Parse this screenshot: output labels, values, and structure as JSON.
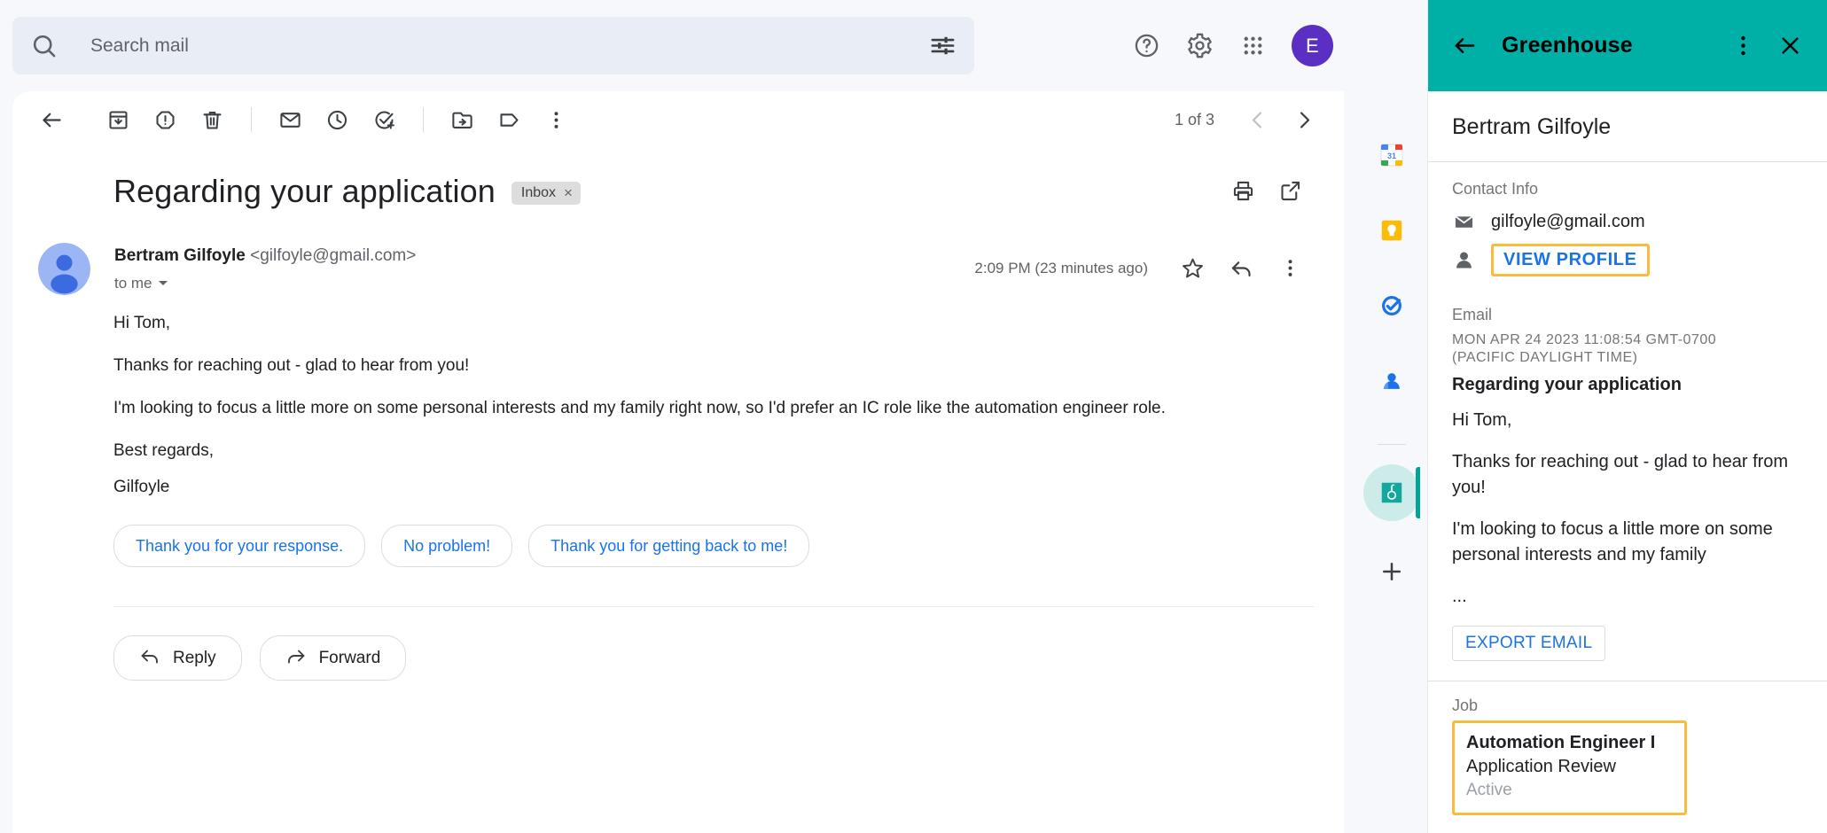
{
  "search": {
    "placeholder": "Search mail",
    "value": "",
    "icon": "search-icon",
    "options_icon": "filter-options-icon"
  },
  "top_right": {
    "help_icon": "help-icon",
    "settings_icon": "gear-icon",
    "apps_icon": "apps-grid-icon",
    "account_initial": "E",
    "account_color": "#5b2ec4"
  },
  "toolbar": {
    "back": "back-arrow-icon",
    "archive": "archive-icon",
    "spam": "report-spam-icon",
    "delete": "trash-icon",
    "mark_unread": "mark-unread-envelope-icon",
    "snooze": "clock-snooze-icon",
    "add_task": "add-to-tasks-icon",
    "move_to": "move-to-folder-icon",
    "labels": "label-tag-icon",
    "more": "more-vertical-icon",
    "pager_text": "1 of 3",
    "prev": "chevron-left-icon",
    "next": "chevron-right-icon"
  },
  "thread": {
    "subject": "Regarding your application",
    "label_chip": "Inbox",
    "label_chip_remove": "×",
    "print_icon": "print-icon",
    "popout_icon": "open-in-new-icon"
  },
  "message": {
    "sender_name": "Bertram Gilfoyle",
    "sender_email": "<gilfoyle@gmail.com>",
    "recipient": "to me",
    "timestamp": "2:09 PM (23 minutes ago)",
    "star_icon": "star-outline-icon",
    "reply_icon": "reply-arrow-icon",
    "more_icon": "more-vertical-icon",
    "body": {
      "greeting": "Hi Tom,",
      "para1": "Thanks for reaching out - glad to hear from you!",
      "para2": "I'm looking to focus a little more on some personal interests and my family right now, so I'd prefer an IC role like the automation engineer role.",
      "signoff": "Best regards,",
      "signature": "Gilfoyle"
    }
  },
  "smart_replies": [
    "Thank you for your response.",
    "No problem!",
    "Thank you for getting back to me!"
  ],
  "actions": {
    "reply_label": "Reply",
    "reply_icon": "reply-arrow-icon",
    "forward_label": "Forward",
    "forward_icon": "forward-arrow-icon"
  },
  "rail": {
    "items": [
      {
        "name": "google-calendar",
        "label": "31"
      },
      {
        "name": "google-keep",
        "label": ""
      },
      {
        "name": "google-tasks",
        "label": ""
      },
      {
        "name": "google-contacts",
        "label": ""
      }
    ],
    "addon": {
      "name": "greenhouse",
      "label": "g",
      "active": true
    },
    "add_label": "+"
  },
  "panel": {
    "title": "Greenhouse",
    "header_color": "#00b0a6",
    "back_icon": "back-arrow-icon",
    "more_icon": "more-vertical-icon",
    "close_icon": "close-icon",
    "candidate_name": "Bertram Gilfoyle",
    "contact": {
      "section_label": "Contact Info",
      "email_icon": "envelope-icon",
      "email": "gilfoyle@gmail.com",
      "profile_icon": "person-icon",
      "view_profile_label": "VIEW PROFILE",
      "view_profile_highlight": "#fbbc3d"
    },
    "email": {
      "section_label": "Email",
      "timestamp_line1": "MON APR 24 2023 11:08:54 GMT-0700",
      "timestamp_line2": "(PACIFIC DAYLIGHT TIME)",
      "subject": "Regarding your application",
      "preview_p1": "Hi Tom,",
      "preview_p2": "Thanks for reaching out - glad to hear from you!",
      "preview_p3": "I'm looking to focus a little more on some personal interests and my family",
      "preview_p4": "...",
      "export_label": "EXPORT EMAIL"
    },
    "job": {
      "section_label": "Job",
      "title": "Automation Engineer I",
      "stage": "Application Review",
      "status": "Active",
      "highlight": "#fbbc3d"
    }
  }
}
